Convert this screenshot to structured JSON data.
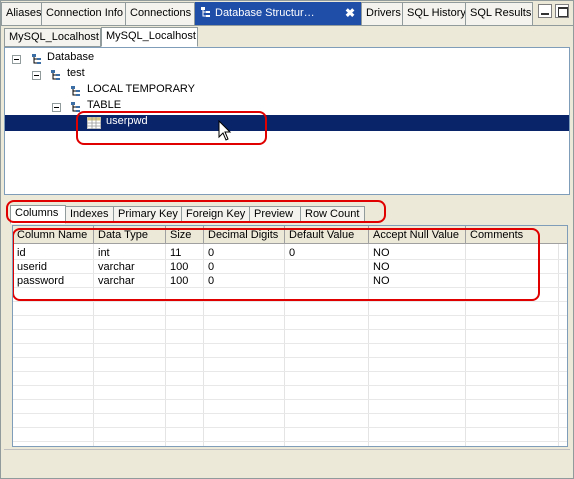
{
  "view_tabs": [
    {
      "label": "Aliases"
    },
    {
      "label": "Connection Info"
    },
    {
      "label": "Connections"
    },
    {
      "label": "Database Structur…",
      "active": true,
      "close": "✖"
    },
    {
      "label": "Drivers"
    },
    {
      "label": "SQL History"
    },
    {
      "label": "SQL Results"
    }
  ],
  "session_tabs": [
    {
      "label": "MySQL_Localhost"
    },
    {
      "label": "MySQL_Localhost",
      "active": true
    }
  ],
  "tree": {
    "nodes": [
      {
        "label": "Database",
        "icon": "database-tree-icon"
      },
      {
        "label": "test",
        "icon": "schema-tree-icon"
      },
      {
        "label": "LOCAL TEMPORARY",
        "icon": "folder-tree-icon"
      },
      {
        "label": "TABLE",
        "icon": "folder-tree-icon"
      },
      {
        "label": "userpwd",
        "icon": "table-icon",
        "selected": true
      }
    ]
  },
  "detail_tabs": [
    {
      "label": "Columns",
      "active": true
    },
    {
      "label": "Indexes"
    },
    {
      "label": "Primary Key"
    },
    {
      "label": "Foreign Key"
    },
    {
      "label": "Preview"
    },
    {
      "label": "Row Count"
    }
  ],
  "columns_table": {
    "headers": [
      "Column Name",
      "Data Type",
      "Size",
      "Decimal Digits",
      "Default Value",
      "Accept Null Value",
      "Comments"
    ],
    "rows": [
      [
        "id",
        "int",
        "11",
        "0",
        "0",
        "NO",
        ""
      ],
      [
        "userid",
        "varchar",
        "100",
        "0",
        "",
        "NO",
        ""
      ],
      [
        "password",
        "varchar",
        "100",
        "0",
        "",
        "NO",
        ""
      ]
    ]
  },
  "colors": {
    "active_tab": "#1f4ea8",
    "selection": "#0a246a",
    "highlight": "#e00000"
  }
}
